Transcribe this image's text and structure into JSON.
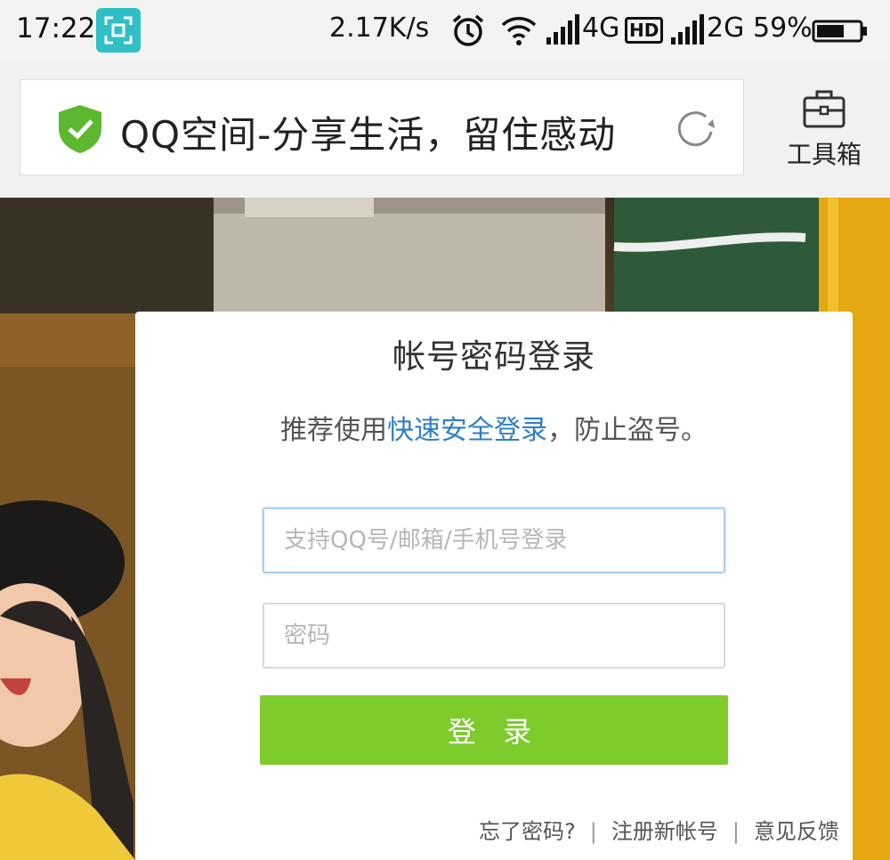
{
  "status_bar": {
    "time": "17:22",
    "net_speed": "2.17K/s",
    "network_1": "4G",
    "hd_badge": "HD",
    "network_2": "2G",
    "battery": "59%",
    "icons": [
      "screenshot-icon",
      "alarm-icon",
      "wifi-icon",
      "signal-icon",
      "battery-icon"
    ]
  },
  "toolbar": {
    "page_title": "QQ空间-分享生活，留住感动",
    "toolbox_label": "工具箱",
    "icons": [
      "security-shield-icon",
      "reload-icon",
      "toolbox-icon"
    ]
  },
  "login": {
    "title": "帐号密码登录",
    "hint_before": "推荐使用",
    "hint_link": "快速安全登录",
    "hint_after": "，防止盗号。",
    "username_placeholder": "支持QQ号/邮箱/手机号登录",
    "password_placeholder": "密码",
    "login_button": "登 录",
    "forgot_password": "忘了密码?",
    "register": "注册新帐号",
    "feedback": "意见反馈"
  },
  "colors": {
    "accent_green": "#7ecb2c",
    "link_blue": "#2f7fc8",
    "shield_green": "#5cb82e",
    "screenshot_teal": "#2fc0c7"
  }
}
